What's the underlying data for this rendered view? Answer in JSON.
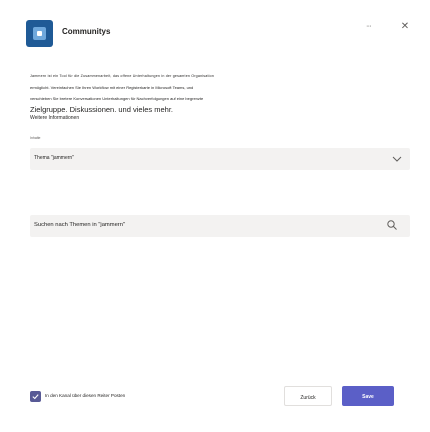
{
  "header": {
    "app_name": "Communitys",
    "minimize_label": "···",
    "close_label": "✕",
    "app_icon": "app-logo-icon",
    "accent_color": "#1f5a96"
  },
  "description": {
    "line1": "Jammern ist ein Tool für die Zusammenarbeit, das offene Unterhaltungen in der gesamten Organisation",
    "line2": "ermöglicht. Vereinfachen Sie Ihren Workflow mit einer Registerkarte in Microsoft Teams, und",
    "line3": "verschieben Sie bretere Konversationen Unterhaltungen für Nachverfolgungen auf eine begrenzte",
    "line4": "Zielgruppe. Diskussionen. und vieles mehr.",
    "more_link": "Weitere Informationen"
  },
  "topic": {
    "label": "Inhalte",
    "value": "Thema \"jammern\"",
    "icon": "chevron-down-icon"
  },
  "search": {
    "value": "Suchen nach Themen in \"jammern\"",
    "icon": "search-icon"
  },
  "footer": {
    "checkbox_label": "In den Kanal über diesen Reiter Posten",
    "checkbox_checked": true,
    "back_label": "Zurück",
    "save_label": "Save",
    "primary_color": "#5b5fc7"
  }
}
